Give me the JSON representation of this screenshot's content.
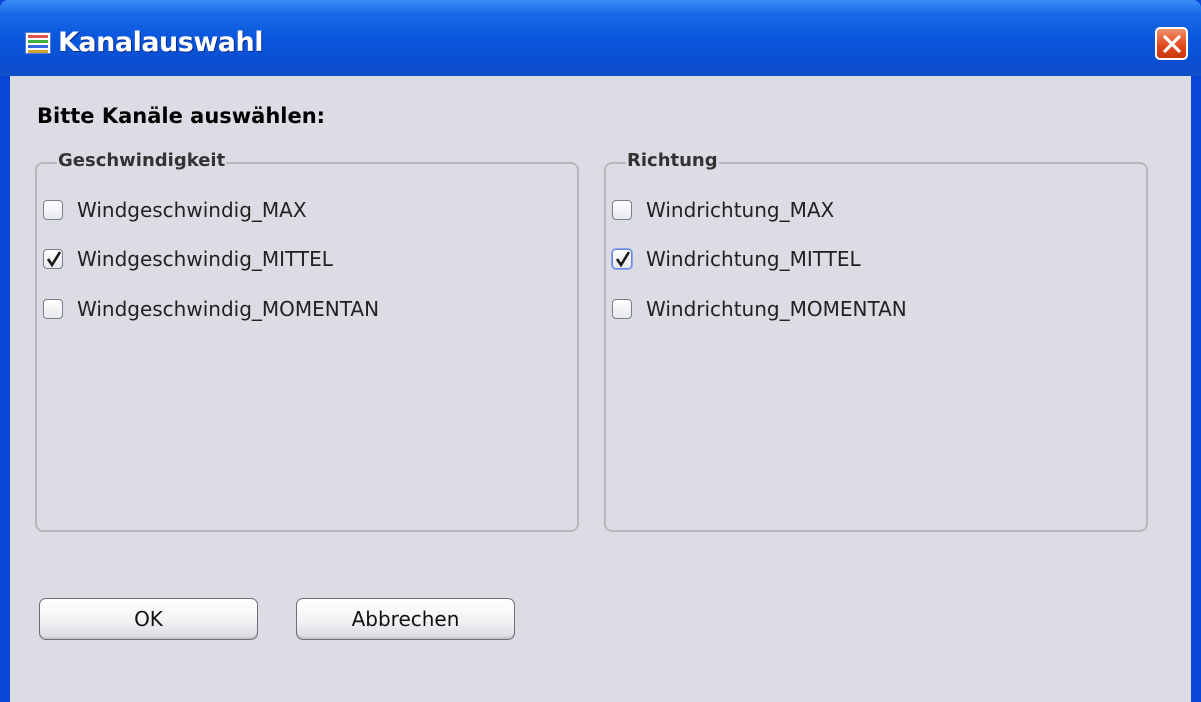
{
  "window": {
    "title": "Kanalauswahl"
  },
  "heading": "Bitte Kanäle auswählen:",
  "groups": {
    "speed": {
      "legend": "Geschwindigkeit",
      "items": [
        {
          "label": "Windgeschwindig_MAX",
          "checked": false
        },
        {
          "label": "Windgeschwindig_MITTEL",
          "checked": true
        },
        {
          "label": "Windgeschwindig_MOMENTAN",
          "checked": false
        }
      ]
    },
    "direction": {
      "legend": "Richtung",
      "items": [
        {
          "label": "Windrichtung_MAX",
          "checked": false
        },
        {
          "label": "Windrichtung_MITTEL",
          "checked": true
        },
        {
          "label": "Windrichtung_MOMENTAN",
          "checked": false
        }
      ]
    }
  },
  "buttons": {
    "ok": "OK",
    "cancel": "Abbrechen"
  },
  "colors": {
    "titlebar": "#0a56dc",
    "close": "#e0481a",
    "dialog_bg": "#dcdde4"
  }
}
